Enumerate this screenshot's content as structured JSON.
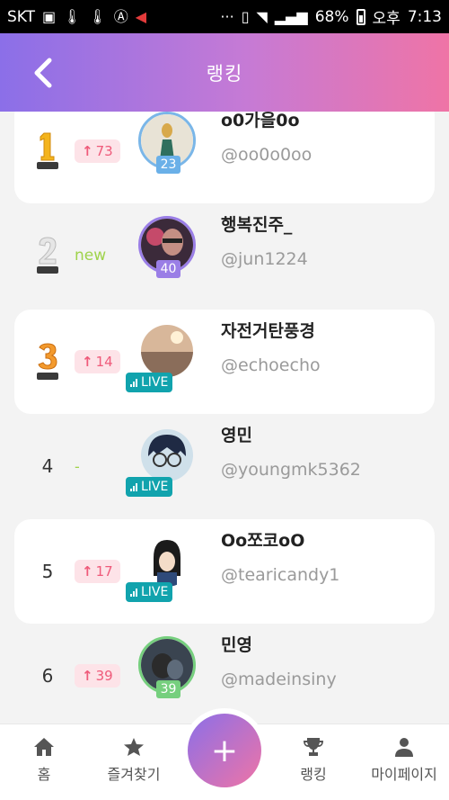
{
  "status": {
    "carrier": "SKT",
    "battery": "68%",
    "ampm": "오후",
    "time": "7:13"
  },
  "header": {
    "title": "랭킹"
  },
  "rankings": [
    {
      "rank": "1",
      "change_type": "up",
      "change": "73",
      "name": "o0가을0o",
      "handle": "@oo0o0oo",
      "level": "23",
      "badge": "level"
    },
    {
      "rank": "2",
      "change_type": "new",
      "change": "new",
      "name": "행복진주_",
      "handle": "@jun1224",
      "level": "40",
      "badge": "level"
    },
    {
      "rank": "3",
      "change_type": "up",
      "change": "14",
      "name": "자전거탄풍경",
      "handle": "@echoecho",
      "badge": "live",
      "live_label": "LIVE"
    },
    {
      "rank": "4",
      "change_type": "same",
      "change": "-",
      "name": "영민",
      "handle": "@youngmk5362",
      "badge": "live",
      "live_label": "LIVE"
    },
    {
      "rank": "5",
      "change_type": "up",
      "change": "17",
      "name": "Oo쪼코oO",
      "handle": "@tearicandy1",
      "badge": "live",
      "live_label": "LIVE"
    },
    {
      "rank": "6",
      "change_type": "up",
      "change": "39",
      "name": "민영",
      "handle": "@madeinsiny",
      "level": "39",
      "badge": "level"
    }
  ],
  "nav": {
    "home": "홈",
    "favorites": "즐겨찾기",
    "add": "+",
    "ranking": "랭킹",
    "mypage": "마이페이지"
  },
  "colors": {
    "accent_start": "#8b6fe8",
    "accent_end": "#ef74a6",
    "up": "#ef5a7a",
    "new": "#9fd34b",
    "live": "#11a3ad"
  }
}
